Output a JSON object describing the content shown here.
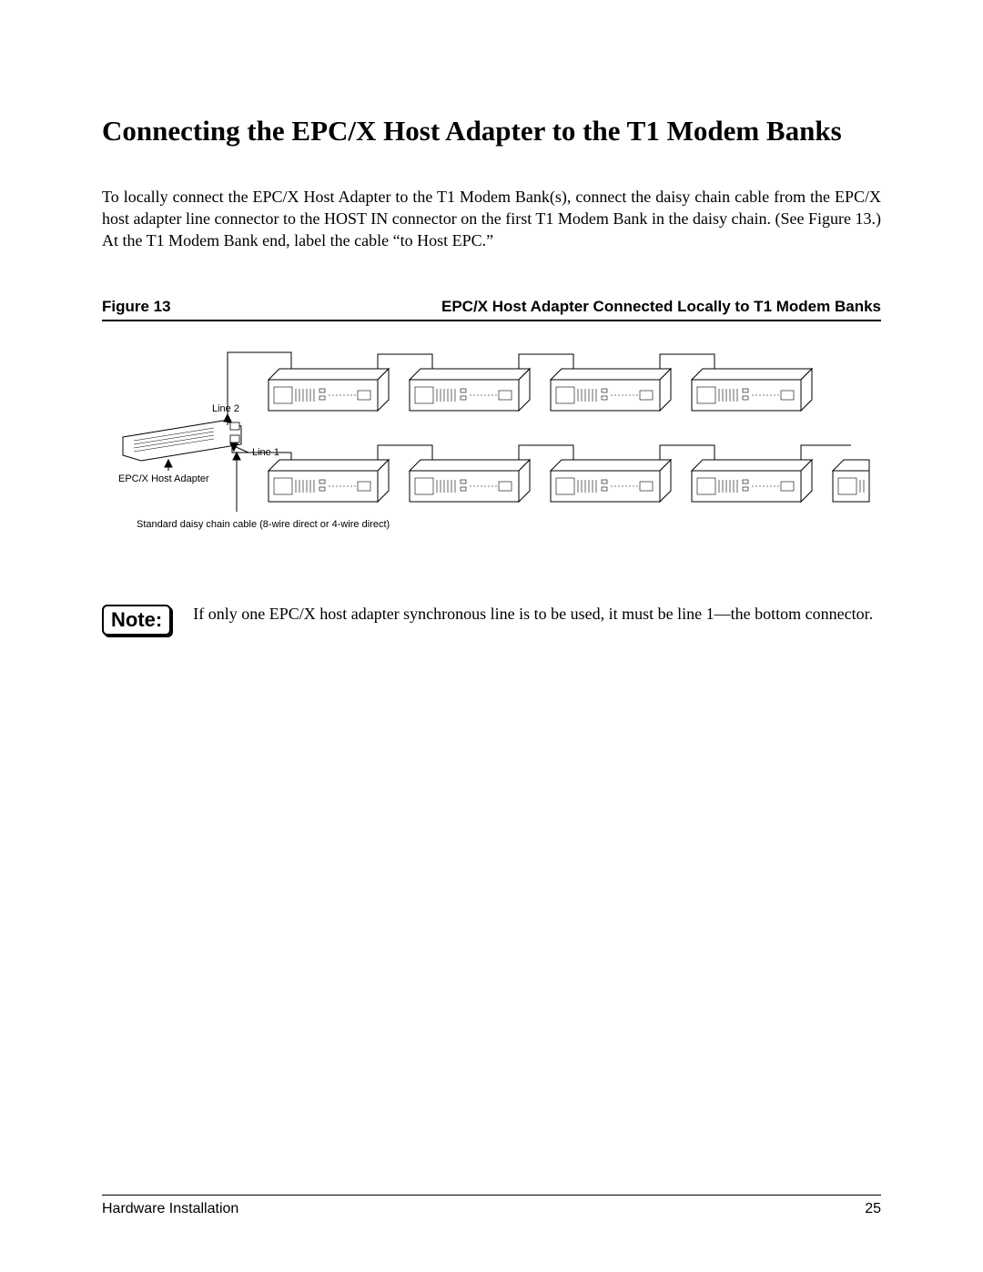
{
  "heading": "Connecting the EPC/X Host Adapter to the T1 Modem Banks",
  "paragraph": "To locally connect the EPC/X Host Adapter to the T1 Modem Bank(s), connect the daisy chain cable from the EPC/X host adapter line connector to the HOST IN connector on the first T1 Modem Bank in the daisy chain. (See Figure 13.) At the T1 Modem Bank end, label the cable “to Host EPC.”",
  "figure": {
    "label": "Figure 13",
    "title": "EPC/X Host Adapter Connected Locally to T1 Modem Banks",
    "labels": {
      "line1": "Line 1",
      "line2": "Line 2",
      "adapter": "EPC/X Host Adapter",
      "cable_caption": "Standard daisy chain cable (8-wire direct or 4-wire direct)"
    }
  },
  "note": {
    "badge": "Note:",
    "text": "If  only one EPC/X host adapter synchronous line is to be used, it must be line 1—the bottom connector."
  },
  "footer": {
    "section": "Hardware Installation",
    "page": "25"
  }
}
